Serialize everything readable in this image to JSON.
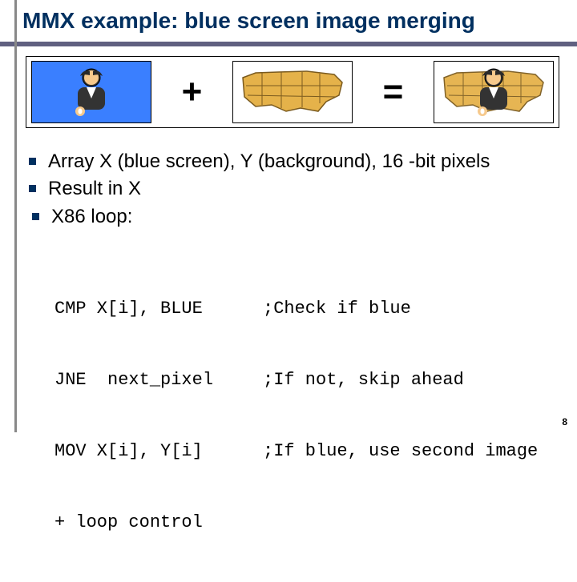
{
  "title": "MMX example: blue screen image merging",
  "diagram": {
    "op_plus": "+",
    "op_equals": "="
  },
  "bullets": [
    "Array X (blue screen), Y (background), 16 -bit pixels",
    "Result in X",
    " X86 loop:"
  ],
  "code": {
    "lines": [
      {
        "instr": "CMP X[i], BLUE",
        "comment": ";Check if blue"
      },
      {
        "instr": "JNE  next_pixel",
        "comment": ";If not, skip ahead"
      },
      {
        "instr": "MOV X[i], Y[i]",
        "comment": ";If blue, use second image"
      },
      {
        "instr": "+ loop control",
        "comment": ""
      }
    ]
  },
  "page_number": "8"
}
